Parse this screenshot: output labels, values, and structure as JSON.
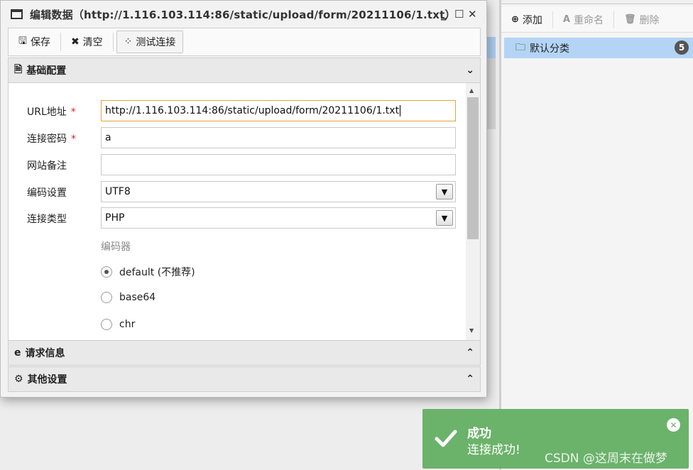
{
  "dialog": {
    "title": "编辑数据（http://1.116.103.114:86/static/upload/form/20211106/1.txt）",
    "controls": {
      "minimize": "‗",
      "maximize": "☐",
      "close": "✕"
    }
  },
  "toolbar": {
    "save_label": "保存",
    "clear_label": "清空",
    "test_label": "测试连接"
  },
  "sections": {
    "basic": "基础配置",
    "request": "请求信息",
    "other": "其他设置"
  },
  "form": {
    "url_label": "URL地址",
    "url_value": "http://1.116.103.114:86/static/upload/form/20211106/1.txt",
    "password_label": "连接密码",
    "password_value": "a",
    "note_label": "网站备注",
    "note_value": "",
    "encoding_label": "编码设置",
    "encoding_value": "UTF8",
    "type_label": "连接类型",
    "type_value": "PHP",
    "encoder_label": "编码器",
    "required_mark": "*",
    "encoders": [
      {
        "label": "default (不推荐)",
        "selected": true
      },
      {
        "label": "base64",
        "selected": false
      },
      {
        "label": "chr",
        "selected": false
      }
    ]
  },
  "right_panel": {
    "add_label": "添加",
    "rename_label": "重命名",
    "delete_label": "删除",
    "category_label": "默认分类",
    "category_count": "5"
  },
  "toast": {
    "title": "成功",
    "message": "连接成功!",
    "color": "#6bb26b"
  },
  "watermark": "CSDN @这周末在做梦"
}
